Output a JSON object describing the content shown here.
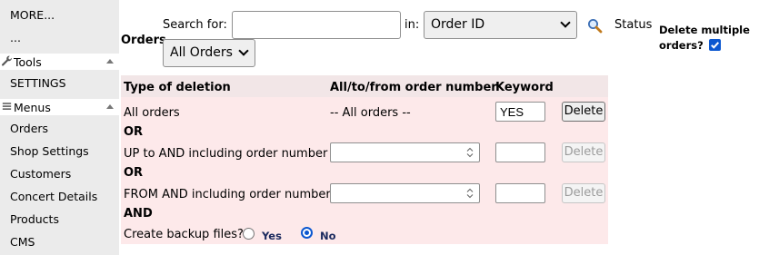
{
  "sidebar": {
    "more": "MORE...",
    "ellipsis": "...",
    "tools_label": "Tools",
    "settings": "SETTINGS",
    "menus_label": "Menus",
    "items": [
      "Orders",
      "Shop Settings",
      "Customers",
      "Concert Details",
      "Products",
      "CMS"
    ]
  },
  "toolbar": {
    "orders_label": "Orders",
    "search_label": "Search for:",
    "search_value": "",
    "in_label": "in:",
    "field_selected": "Order ID",
    "status_label": "Status",
    "status_selected": "All Orders",
    "delete_multiple_line1": "Delete multiple",
    "delete_multiple_line2": "orders?",
    "delete_multiple_checked": true
  },
  "table": {
    "headers": [
      "Type of deletion",
      "All/to/from order number",
      "Keyword"
    ],
    "rows": {
      "all_orders": {
        "label": "All orders",
        "range_text": "-- All orders --",
        "keyword": "YES",
        "button": "Delete"
      },
      "or1": "OR",
      "up_to": {
        "label": "UP to AND including order number",
        "keyword": "",
        "button": "Delete"
      },
      "or2": "OR",
      "from": {
        "label": "FROM AND including order number",
        "keyword": "",
        "button": "Delete"
      },
      "and": "AND",
      "backup": {
        "label": "Create backup files?",
        "yes": "Yes",
        "no": "No",
        "selected": "No"
      }
    }
  },
  "colors": {
    "sidebar_bg": "#ebebeb",
    "panel_bg": "#fde9ea",
    "accent": "#0b57d0"
  }
}
